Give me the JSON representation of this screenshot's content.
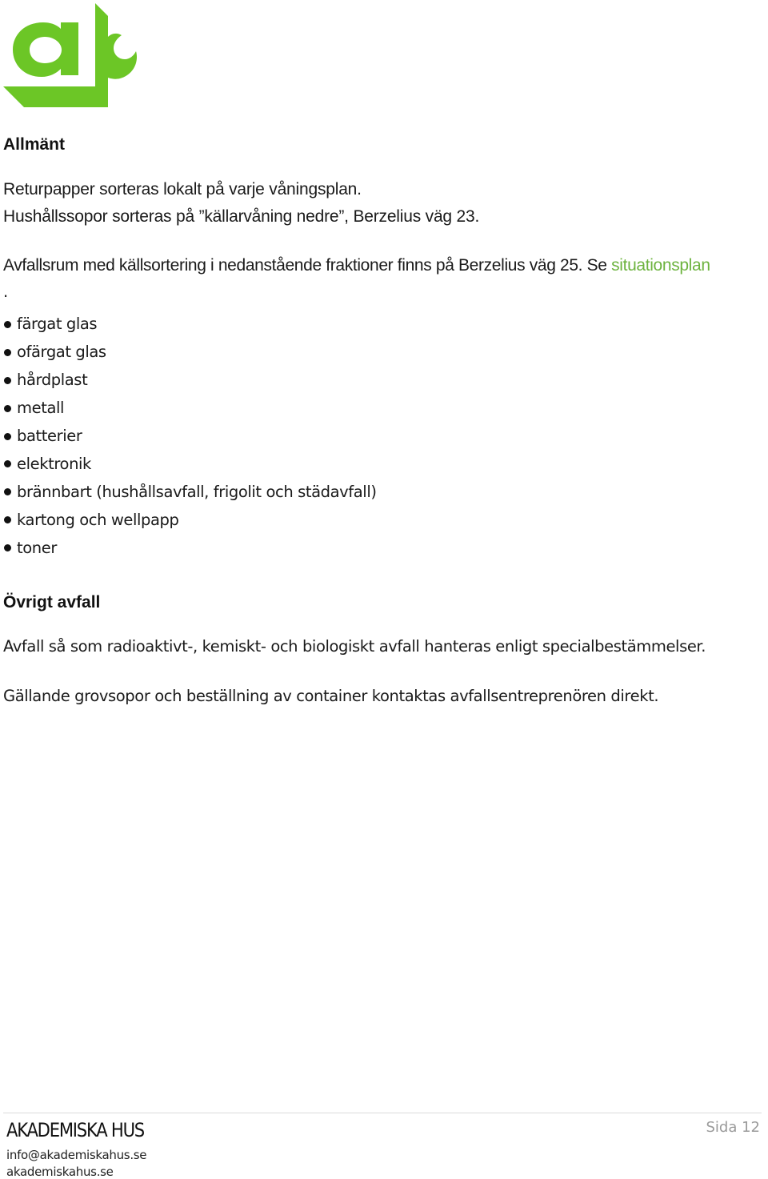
{
  "logo": {
    "name": "Akademiska Hus logo",
    "color": "#6cc626"
  },
  "sections": {
    "general": {
      "heading": "Allmänt",
      "lines": [
        "Returpapper sorteras lokalt på varje våningsplan.",
        "Hushållssopor sorteras på ”källarvåning nedre”, Berzelius väg 23."
      ],
      "recycling_text": "Avfallsrum med källsortering i nedanstående fraktioner finns på Berzelius väg 25. Se ",
      "recycling_link": "situationsplan",
      "recycling_trailing": ".",
      "fractions": [
        "färgat glas",
        "ofärgat glas",
        "hårdplast",
        "metall",
        "batterier",
        "elektronik",
        "brännbart (hushållsavfall, frigolit och städavfall)",
        "kartong och wellpapp",
        "toner"
      ]
    },
    "other_waste": {
      "heading": "Övrigt avfall",
      "paragraphs": [
        "Avfall så som radioaktivt-, kemiskt- och biologiskt avfall hanteras enligt specialbestämmelser.",
        "Gällande grovsopor och beställning av container kontaktas avfallsentreprenören direkt."
      ]
    }
  },
  "footer": {
    "brand": "AKADEMISKA HUS",
    "email": "info@akademiskahus.se",
    "website": "akademiskahus.se",
    "page_label": "Sida 12"
  },
  "colors": {
    "accent": "#6db33f",
    "page_number": "#9a9a9a"
  }
}
